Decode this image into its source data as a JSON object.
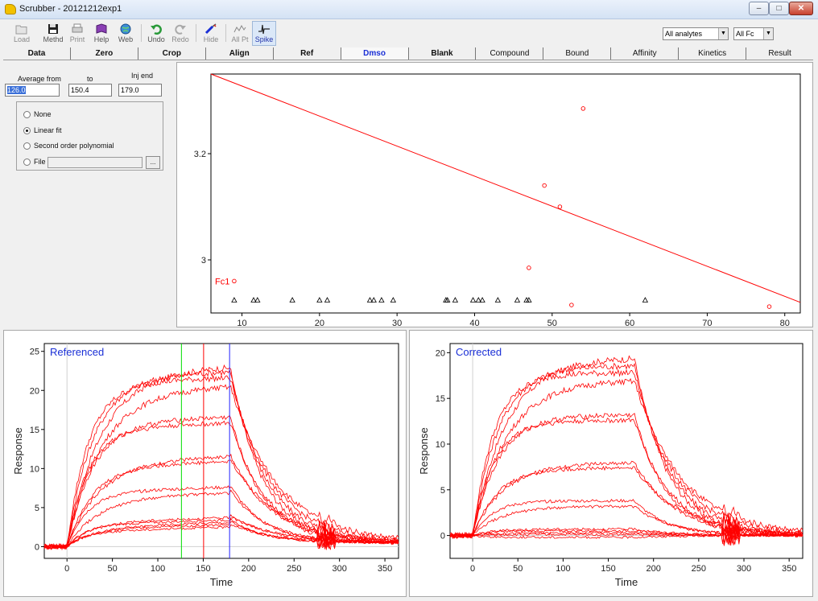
{
  "window": {
    "title": "Scrubber - 20121212exp1",
    "min_label": "–",
    "max_label": "□",
    "close_label": "✕"
  },
  "toolbar": {
    "buttons": [
      {
        "label": "Load",
        "icon": "folder-icon"
      },
      {
        "label": "Methd",
        "icon": "save-icon"
      },
      {
        "label": "Print",
        "icon": "printer-icon"
      },
      {
        "label": "Help",
        "icon": "book-icon"
      },
      {
        "label": "Web",
        "icon": "globe-icon"
      },
      {
        "label": "Undo",
        "icon": "undo-icon"
      },
      {
        "label": "Redo",
        "icon": "redo-icon"
      },
      {
        "label": "Hide",
        "icon": "syringe-icon"
      },
      {
        "label": "All Pt",
        "icon": "points-icon"
      },
      {
        "label": "Spike",
        "icon": "spike-icon"
      }
    ],
    "analyte_select": "All analytes",
    "fc_select": "All Fc"
  },
  "tabs": [
    "Data",
    "Zero",
    "Crop",
    "Align",
    "Ref",
    "Dmso",
    "Blank",
    "Compound",
    "Bound",
    "Affinity",
    "Kinetics",
    "Result"
  ],
  "active_tab": "Dmso",
  "dmso_panel": {
    "avg_from_label": "Average from",
    "to_label": "to",
    "inj_end_label": "Inj end",
    "avg_from": "126.0",
    "to": "150.4",
    "inj_end": "179.0",
    "options": [
      "None",
      "Linear fit",
      "Second order polynomial",
      "File"
    ],
    "selected": "Linear fit",
    "file_button": "..."
  },
  "colors": {
    "curve": "#ff0000",
    "label_blue": "#1a2fd6",
    "green_marker": "#00dd00",
    "blue_marker": "#2222ff"
  },
  "chart_data": [
    {
      "type": "scatter",
      "series_label": "Fc1",
      "xlim": [
        6,
        82
      ],
      "ylim": [
        2.9,
        3.35
      ],
      "xticks": [
        "10",
        "20",
        "30",
        "40",
        "50",
        "60",
        "70",
        "80"
      ],
      "yticks": [
        "3",
        "3.2"
      ],
      "fit_line": [
        [
          6,
          3.35
        ],
        [
          82,
          2.92
        ]
      ],
      "circle_points": [
        [
          9,
          2.96
        ],
        [
          47,
          2.985
        ],
        [
          49,
          3.14
        ],
        [
          51,
          3.1
        ],
        [
          52.5,
          2.915
        ],
        [
          54,
          3.285
        ],
        [
          78,
          2.912
        ]
      ],
      "triangle_points_x": [
        9,
        11.5,
        12,
        16.5,
        20,
        21,
        26.5,
        27,
        28,
        29.5,
        36.3,
        36.5,
        37.5,
        39.8,
        40.5,
        41,
        43,
        45.5,
        46.7,
        47,
        62
      ]
    },
    {
      "type": "line",
      "label": "Referenced",
      "xlabel": "Time",
      "ylabel": "Response",
      "xlim": [
        -25,
        365
      ],
      "ylim": [
        -1.5,
        26
      ],
      "xticks": [
        "0",
        "50",
        "100",
        "150",
        "200",
        "250",
        "300",
        "350"
      ],
      "yticks": [
        "0",
        "5",
        "10",
        "15",
        "20",
        "25"
      ],
      "markers": [
        {
          "x": 126,
          "color": "green"
        },
        {
          "x": 150.4,
          "color": "red"
        },
        {
          "x": 179,
          "color": "blue"
        }
      ],
      "plateaus": [
        22.5,
        21.8,
        21.0,
        20.0,
        16.0,
        15.2,
        11.0,
        10.3,
        7.0,
        6.3,
        3.1,
        2.8,
        2.5,
        2.2,
        1.9
      ],
      "drift": 0.6,
      "spike_x": 285
    },
    {
      "type": "line",
      "label": "Corrected",
      "xlabel": "Time",
      "ylabel": "Response",
      "xlim": [
        -25,
        365
      ],
      "ylim": [
        -2.5,
        21
      ],
      "xticks": [
        "0",
        "50",
        "100",
        "150",
        "200",
        "250",
        "300",
        "350"
      ],
      "yticks": [
        "0",
        "5",
        "10",
        "15",
        "20"
      ],
      "plateaus": [
        19.5,
        18.6,
        17.8,
        17.0,
        13.2,
        12.6,
        8.0,
        7.4,
        3.8,
        3.2,
        0.7,
        0.5,
        0.3,
        0.1,
        -0.2
      ],
      "drift": 0.0,
      "spike_x": 285
    }
  ]
}
